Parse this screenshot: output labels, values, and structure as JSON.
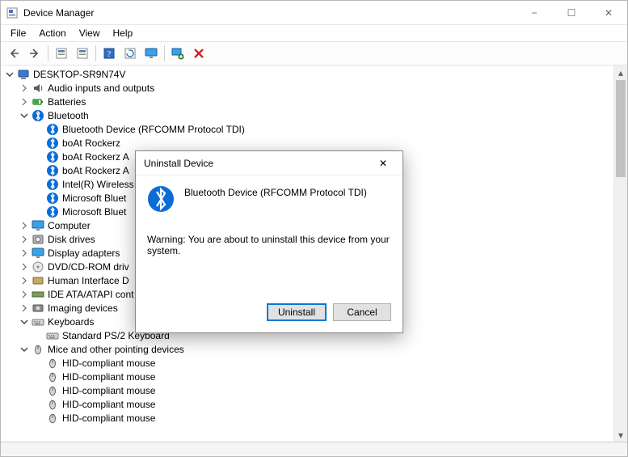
{
  "window": {
    "title": "Device Manager",
    "min_icon": "−",
    "max_icon": "☐",
    "close_icon": "✕"
  },
  "menu": {
    "items": [
      "File",
      "Action",
      "View",
      "Help"
    ]
  },
  "toolbar_icons": [
    "nav-back",
    "nav-forward",
    "show-hidden",
    "properties",
    "help",
    "update-driver",
    "monitor",
    "scan-hardware",
    "uninstall"
  ],
  "root": {
    "name": "DESKTOP-SR9N74V",
    "children": [
      {
        "name": "Audio inputs and outputs",
        "icon": "audio",
        "expanded": false,
        "children": []
      },
      {
        "name": "Batteries",
        "icon": "battery",
        "expanded": false,
        "children": []
      },
      {
        "name": "Bluetooth",
        "icon": "bt",
        "expanded": true,
        "children": [
          {
            "name": "Bluetooth Device (RFCOMM Protocol TDI)",
            "icon": "bt"
          },
          {
            "name": "boAt Rockerz",
            "icon": "bt"
          },
          {
            "name": "boAt Rockerz A",
            "icon": "bt",
            "truncated": true
          },
          {
            "name": "boAt Rockerz A",
            "icon": "bt",
            "truncated": true
          },
          {
            "name": "Intel(R) Wireless",
            "icon": "bt",
            "truncated": true
          },
          {
            "name": "Microsoft Bluet",
            "icon": "bt",
            "truncated": true
          },
          {
            "name": "Microsoft Bluet",
            "icon": "bt",
            "truncated": true
          }
        ]
      },
      {
        "name": "Computer",
        "icon": "computer",
        "expanded": false,
        "children": []
      },
      {
        "name": "Disk drives",
        "icon": "disk",
        "expanded": false,
        "children": []
      },
      {
        "name": "Display adapters",
        "icon": "display",
        "expanded": false,
        "children": []
      },
      {
        "name": "DVD/CD-ROM driv",
        "icon": "dvd",
        "expanded": false,
        "truncated": true,
        "children": []
      },
      {
        "name": "Human Interface D",
        "icon": "hid",
        "expanded": false,
        "truncated": true,
        "children": []
      },
      {
        "name": "IDE ATA/ATAPI cont",
        "icon": "ide",
        "expanded": false,
        "truncated": true,
        "children": []
      },
      {
        "name": "Imaging devices",
        "icon": "imaging",
        "expanded": false,
        "children": []
      },
      {
        "name": "Keyboards",
        "icon": "keyboard",
        "expanded": true,
        "children": [
          {
            "name": "Standard PS/2 Keyboard",
            "icon": "keyboard"
          }
        ]
      },
      {
        "name": "Mice and other pointing devices",
        "icon": "mouse",
        "expanded": true,
        "children": [
          {
            "name": "HID-compliant mouse",
            "icon": "mouse"
          },
          {
            "name": "HID-compliant mouse",
            "icon": "mouse"
          },
          {
            "name": "HID-compliant mouse",
            "icon": "mouse"
          },
          {
            "name": "HID-compliant mouse",
            "icon": "mouse"
          },
          {
            "name": "HID-compliant mouse",
            "icon": "mouse"
          }
        ]
      }
    ]
  },
  "dialog": {
    "title": "Uninstall Device",
    "device_name": "Bluetooth Device (RFCOMM Protocol TDI)",
    "warning": "Warning: You are about to uninstall this device from your system.",
    "uninstall_label": "Uninstall",
    "cancel_label": "Cancel",
    "close_icon": "✕"
  }
}
